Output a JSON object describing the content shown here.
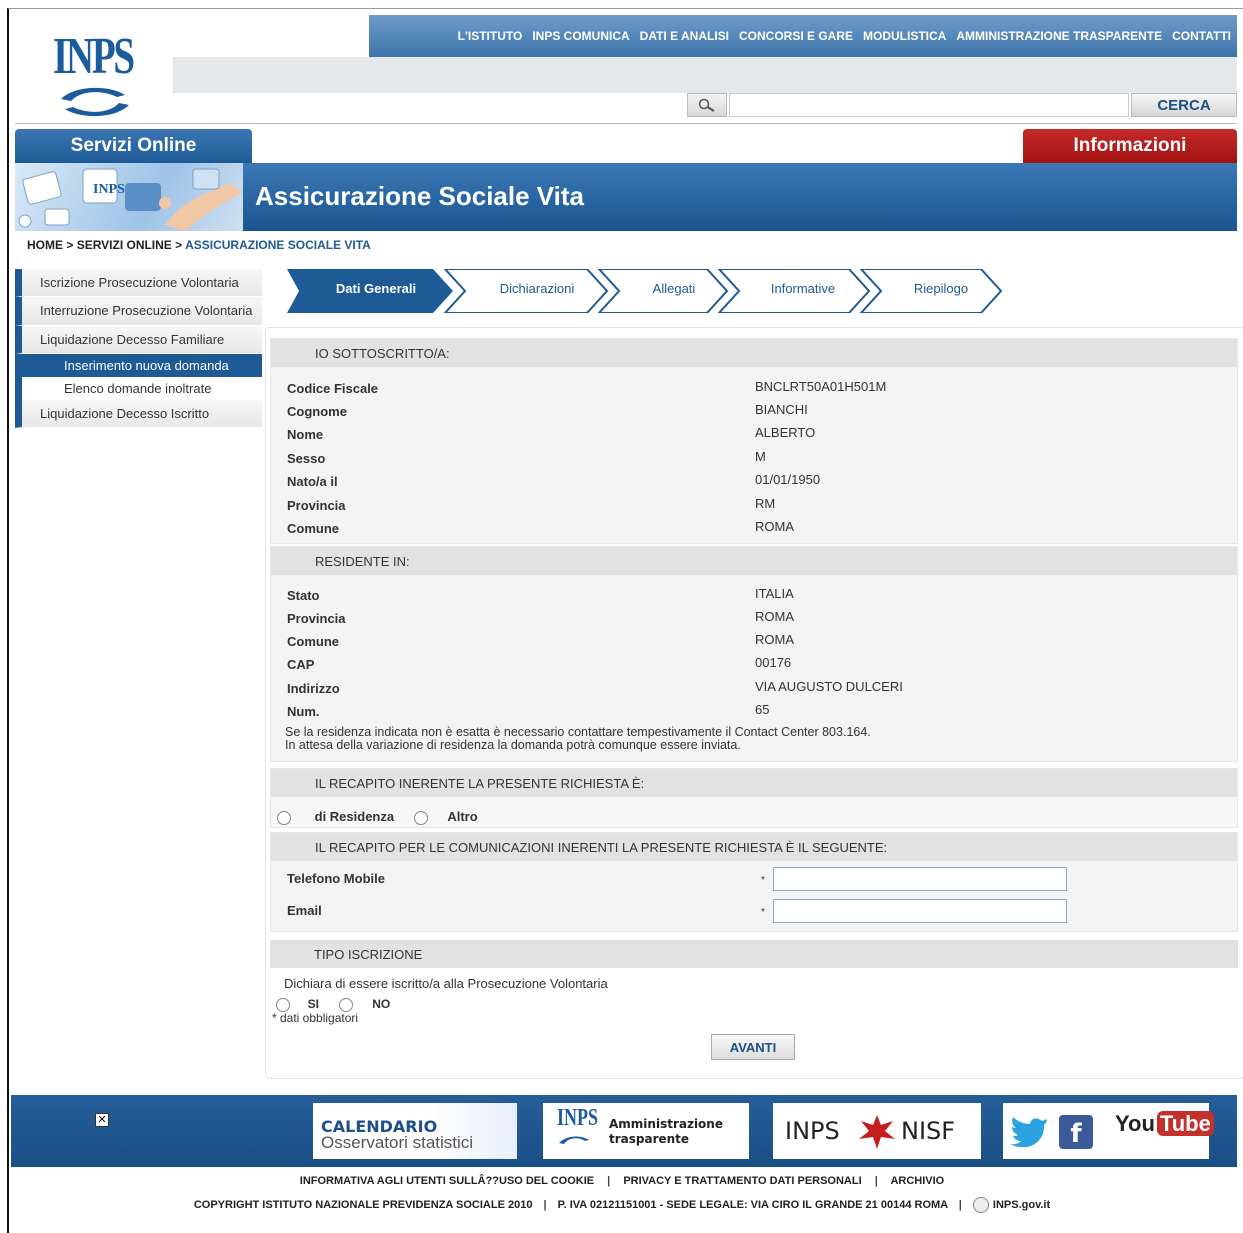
{
  "brand": {
    "logo_text": "INPS"
  },
  "topnav": [
    "L'ISTITUTO",
    "INPS COMUNICA",
    "DATI E ANALISI",
    "CONCORSI E GARE",
    "MODULISTICA",
    "AMMINISTRAZIONE TRASPARENTE",
    "CONTATTI"
  ],
  "search": {
    "button": "CERCA",
    "placeholder": ""
  },
  "tabs": {
    "servizi": "Servizi Online",
    "informazioni": "Informazioni"
  },
  "banner_title": "Assicurazione Sociale Vita",
  "breadcrumb": {
    "home": "HOME",
    "sep": " > ",
    "servizi": "SERVIZI ONLINE",
    "current": "ASSICURAZIONE SOCIALE VITA"
  },
  "sidebar": {
    "items": [
      "Iscrizione Prosecuzione Volontaria",
      "Interruzione Prosecuzione Volontaria",
      "Liquidazione Decesso Familiare",
      "Liquidazione Decesso Iscritto"
    ],
    "sub": [
      "Inserimento nuova domanda",
      "Elenco domande inoltrate"
    ]
  },
  "steps": [
    "Dati Generali",
    "Dichiarazioni",
    "Allegati",
    "Informative",
    "Riepilogo"
  ],
  "sottoscritto": {
    "title": "IO SOTTOSCRITTO/A:",
    "rows": [
      {
        "label": "Codice Fiscale",
        "value": "BNCLRT50A01H501M"
      },
      {
        "label": "Cognome",
        "value": "BIANCHI"
      },
      {
        "label": "Nome",
        "value": "ALBERTO"
      },
      {
        "label": "Sesso",
        "value": "M"
      },
      {
        "label": "Nato/a il",
        "value": "01/01/1950"
      },
      {
        "label": "Provincia",
        "value": "RM"
      },
      {
        "label": "Comune",
        "value": "ROMA"
      }
    ]
  },
  "residente": {
    "title": "RESIDENTE IN:",
    "rows": [
      {
        "label": "Stato",
        "value": "ITALIA"
      },
      {
        "label": "Provincia",
        "value": "ROMA"
      },
      {
        "label": "Comune",
        "value": "ROMA"
      },
      {
        "label": "CAP",
        "value": "00176"
      },
      {
        "label": "Indirizzo",
        "value": "VIA AUGUSTO DULCERI"
      },
      {
        "label": "Num.",
        "value": "65"
      }
    ],
    "note1": "Se la residenza indicata non è esatta è necessario contattare tempestivamente il Contact Center 803.164.",
    "note2": "In attesa della variazione di residenza la domanda potrà comunque essere inviata."
  },
  "recapito": {
    "title": "IL RECAPITO INERENTE LA PRESENTE RICHIESTA È:",
    "opt1": "di Residenza",
    "opt2": "Altro"
  },
  "comunicazioni": {
    "title": "IL RECAPITO PER LE COMUNICAZIONI INERENTI LA PRESENTE RICHIESTA È IL SEGUENTE:",
    "phone_label": "Telefono Mobile",
    "email_label": "Email",
    "required_mark": "*"
  },
  "tipo": {
    "title": "TIPO ISCRIZIONE",
    "question": "Dichiara di essere iscritto/a alla Prosecuzione Volontaria",
    "yes": "SI",
    "no": "NO",
    "required_note": "* dati obbligatori"
  },
  "avanti": "AVANTI",
  "footer": {
    "calendario_1": "CALENDARIO",
    "calendario_2": "Osservatori statistici",
    "amm_logo": "INPS",
    "amm_1": "Amministrazione",
    "amm_2": "trasparente",
    "nisf_1": "INPS",
    "nisf_2": "NISF",
    "youtube_1": "You",
    "youtube_2": "Tube",
    "links": [
      "INFORMATIVA AGLI UTENTI SULLÂ??USO DEL COOKIE",
      "PRIVACY E TRATTAMENTO DATI PERSONALI",
      "ARCHIVIO"
    ],
    "copyright": "COPYRIGHT ISTITUTO NAZIONALE PREVIDENZA SOCIALE 2010",
    "piva": "P. IVA 02121151001 - SEDE LEGALE: VIA CIRO IL GRANDE 21 00144 ROMA",
    "govsite": "INPS.gov.it"
  },
  "colors": {
    "primary": "#1d5a96",
    "accent_red": "#b51c1c"
  }
}
